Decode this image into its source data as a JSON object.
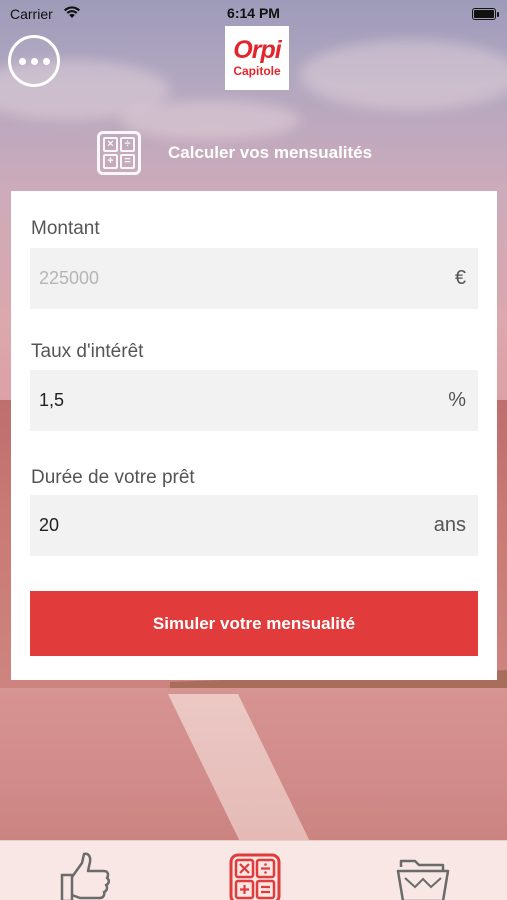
{
  "status_bar": {
    "carrier": "Carrier",
    "time": "6:14 PM"
  },
  "header": {
    "menu_icon": "more-horizontal-icon",
    "logo_brand": "Orpi",
    "logo_agency": "Capitole",
    "title": "Calculer vos mensualités",
    "title_icon": "calculator-icon"
  },
  "form": {
    "amount": {
      "label": "Montant",
      "value": "",
      "placeholder": "225000",
      "unit": "€"
    },
    "rate": {
      "label": "Taux d'intérêt",
      "value": "1,5",
      "placeholder": "",
      "unit": "%"
    },
    "duration": {
      "label": "Durée de votre prêt",
      "value": "20",
      "placeholder": "",
      "unit": "ans"
    },
    "submit_label": "Simuler votre mensualité"
  },
  "tabbar": {
    "tabs": [
      {
        "icon": "thumbs-up-icon",
        "active": false
      },
      {
        "icon": "calculator-icon",
        "active": true
      },
      {
        "icon": "folder-icon",
        "active": false
      }
    ]
  },
  "colors": {
    "accent": "#e13b3b",
    "logo_red": "#e2262b",
    "field_bg": "#f2f2f2",
    "tabbar_bg": "#f8e7e5"
  }
}
